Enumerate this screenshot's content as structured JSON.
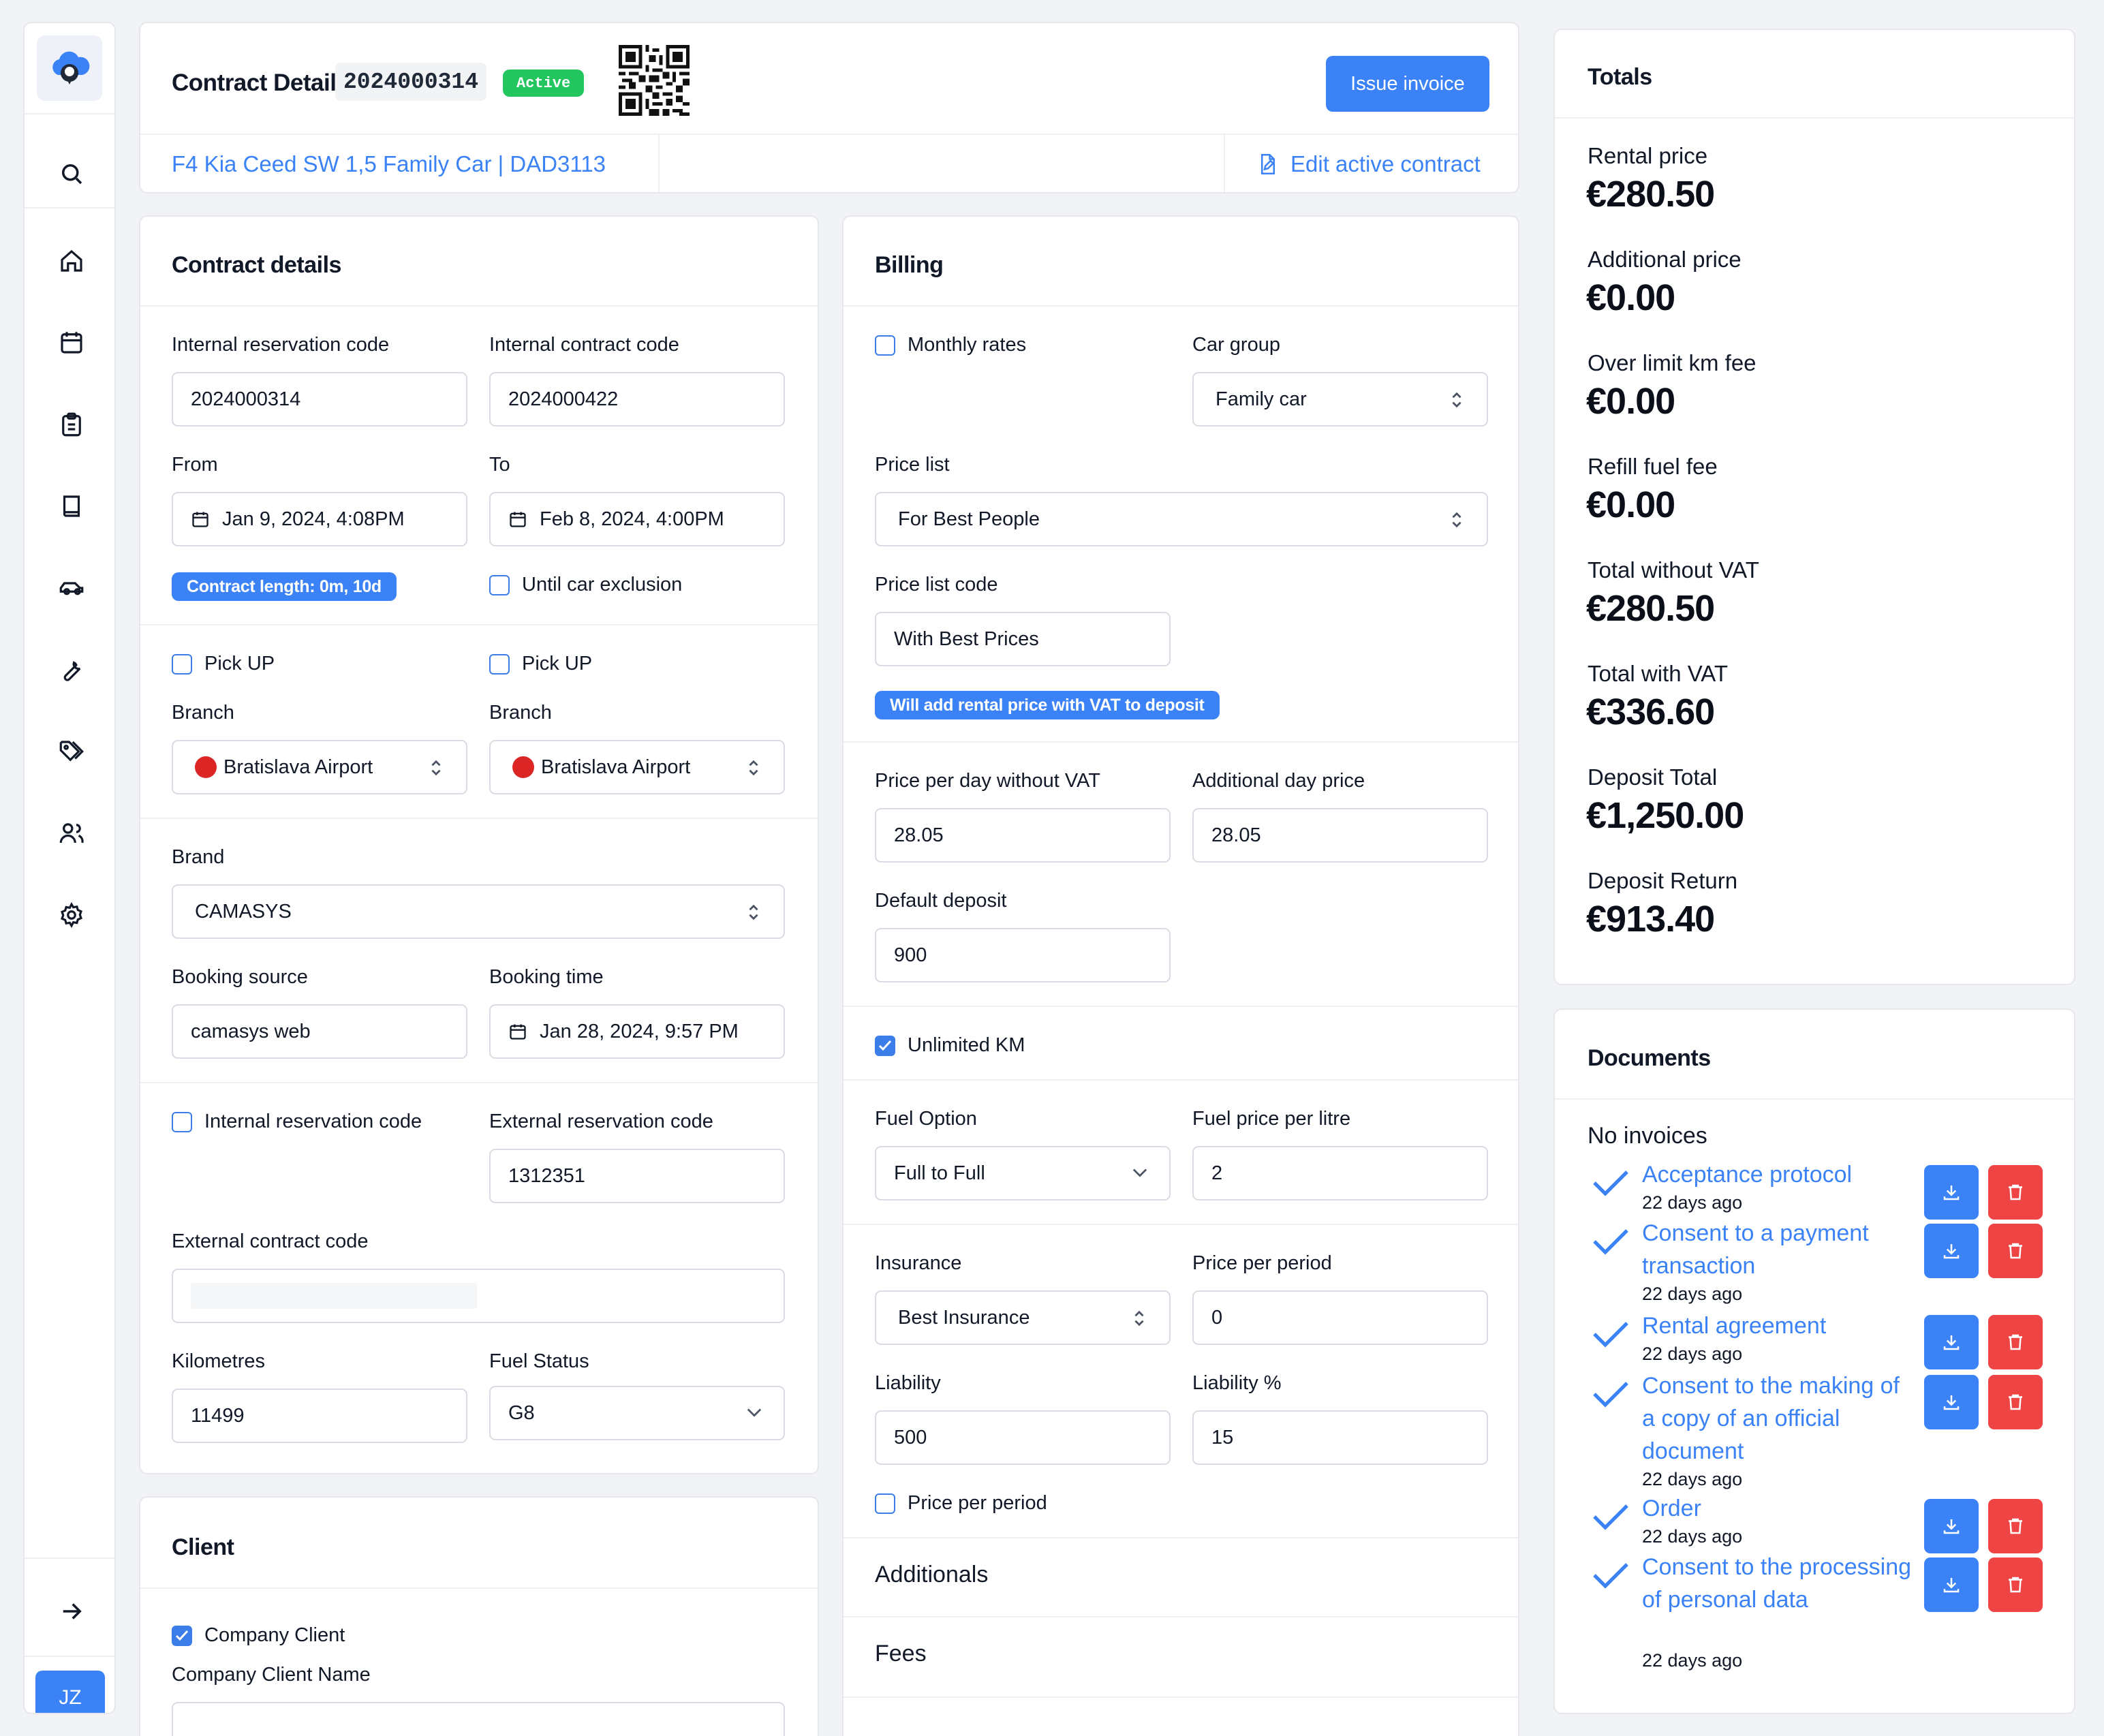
{
  "sidebar": {
    "logo": "cloud-car-logo",
    "items": [
      "search-icon",
      "home-icon",
      "calendar-icon",
      "clipboard-icon",
      "book-icon",
      "car-icon",
      "wrench-icon",
      "tags-icon",
      "users-icon",
      "gear-icon"
    ],
    "collapse_icon": "arrow-right-icon",
    "user_initials": "JZ"
  },
  "header": {
    "title": "Contract Detail",
    "contract_number": "2024000314",
    "status": "Active",
    "issue_invoice_label": "Issue invoice",
    "car_link": "F4 Kia Ceed SW 1,5 Family Car | DAD3113",
    "edit_contract_label": "Edit active contract"
  },
  "contract_details": {
    "title": "Contract details",
    "internal_reservation_code_label": "Internal reservation code",
    "internal_reservation_code": "2024000314",
    "internal_contract_code_label": "Internal contract code",
    "internal_contract_code": "2024000422",
    "from_label": "From",
    "from_value": "Jan 9, 2024, 4:08PM",
    "to_label": "To",
    "to_value": "Feb 8, 2024, 4:00PM",
    "contract_length": "Contract length: 0m, 10d",
    "until_car_exclusion_label": "Until car exclusion",
    "pickup_label_1": "Pick UP",
    "pickup_label_2": "Pick UP",
    "branch_label_1": "Branch",
    "branch_label_2": "Branch",
    "branch_value_1": "Bratislava Airport",
    "branch_value_2": "Bratislava Airport",
    "brand_label": "Brand",
    "brand_value": "CAMASYS",
    "booking_source_label": "Booking source",
    "booking_source_value": "camasys web",
    "booking_time_label": "Booking time",
    "booking_time_value": "Jan 28, 2024, 9:57 PM",
    "internal_reservation_checkbox_label": "Internal reservation code",
    "external_reservation_code_label": "External reservation code",
    "external_reservation_code": "1312351",
    "external_contract_code_label": "External contract code",
    "kilometres_label": "Kilometres",
    "kilometres_value": "11499",
    "fuel_status_label": "Fuel Status",
    "fuel_status_value": "G8"
  },
  "client": {
    "title": "Client",
    "company_client_label": "Company Client",
    "company_client_name_label": "Company Client Name"
  },
  "billing": {
    "title": "Billing",
    "monthly_rates_label": "Monthly rates",
    "car_group_label": "Car group",
    "car_group_value": "Family car",
    "price_list_label": "Price list",
    "price_list_value": "For Best People",
    "price_list_code_label": "Price list code",
    "price_list_code_value": "With Best Prices",
    "deposit_notice": "Will add rental price with VAT to deposit",
    "price_per_day_label": "Price per day without VAT",
    "price_per_day_value": "28.05",
    "additional_day_price_label": "Additional day price",
    "additional_day_price_value": "28.05",
    "default_deposit_label": "Default deposit",
    "default_deposit_value": "900",
    "unlimited_km_label": "Unlimited KM",
    "fuel_option_label": "Fuel Option",
    "fuel_option_value": "Full to Full",
    "fuel_price_label": "Fuel price per litre",
    "fuel_price_value": "2",
    "insurance_label": "Insurance",
    "insurance_value": "Best Insurance",
    "price_per_period_label": "Price per period",
    "price_per_period_value": "0",
    "liability_label": "Liability",
    "liability_value": "500",
    "liability_pct_label": "Liability %",
    "liability_pct_value": "15",
    "price_per_period_checkbox_label": "Price per period",
    "additionals_label": "Additionals",
    "fees_label": "Fees"
  },
  "totals": {
    "title": "Totals",
    "rows": [
      {
        "label": "Rental price",
        "value": "€280.50"
      },
      {
        "label": "Additional price",
        "value": "€0.00"
      },
      {
        "label": "Over limit km fee",
        "value": "€0.00"
      },
      {
        "label": "Refill fuel fee",
        "value": "€0.00"
      },
      {
        "label": "Total without VAT",
        "value": "€280.50"
      },
      {
        "label": "Total with VAT",
        "value": "€336.60"
      },
      {
        "label": "Deposit Total",
        "value": "€1,250.00"
      },
      {
        "label": "Deposit Return",
        "value": "€913.40"
      }
    ]
  },
  "documents": {
    "title": "Documents",
    "no_invoices": "No invoices",
    "items": [
      {
        "name": "Acceptance protocol",
        "ago": "22 days ago"
      },
      {
        "name": "Consent to a payment transaction",
        "ago": "22 days ago"
      },
      {
        "name": "Rental agreement",
        "ago": "22 days ago"
      },
      {
        "name": "Consent to the making of a copy of an official document",
        "ago": "22 days ago"
      },
      {
        "name": "Order",
        "ago": "22 days ago"
      },
      {
        "name": "Consent to the processing of personal data",
        "ago": "22 days ago"
      }
    ]
  },
  "colors": {
    "accent": "#3b82f6",
    "active_badge": "#22c55e",
    "danger": "#ef4444",
    "branch_dot": "#dc2626"
  }
}
